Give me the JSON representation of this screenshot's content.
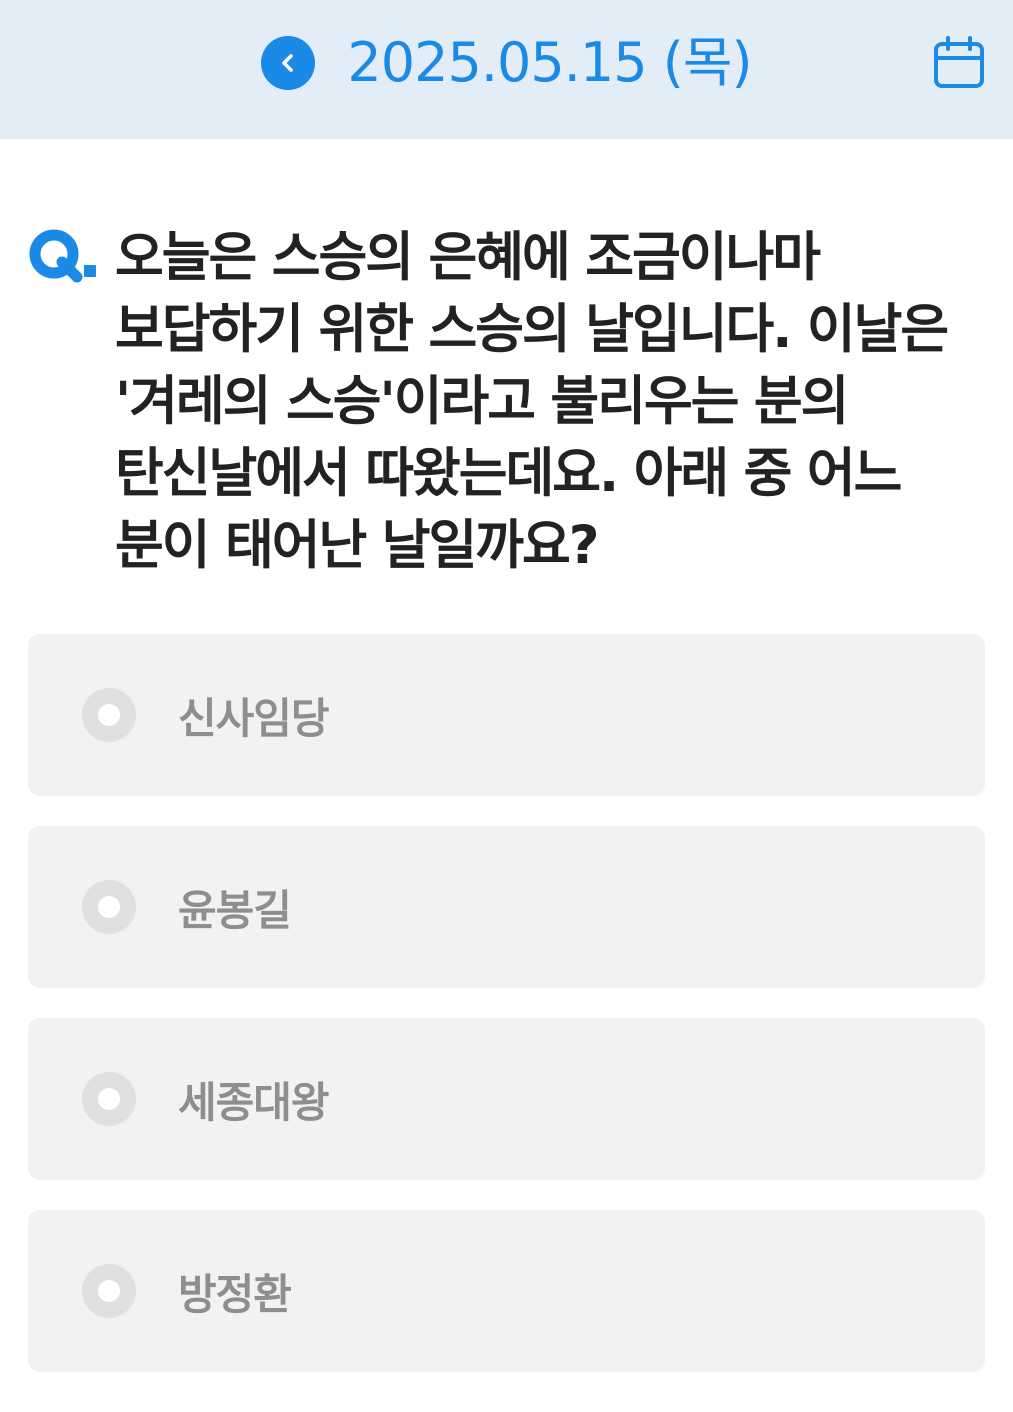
{
  "header": {
    "date": "2025.05.15 (목)",
    "back_icon": "chevron-left-icon",
    "calendar_icon": "calendar-icon",
    "accent_color": "#1a8ae6",
    "background_color": "#e3edf7"
  },
  "question": {
    "marker": "Q.",
    "text": "오늘은 스승의 은혜에 조금이나마 보답하기 위한 스승의 날입니다. 이날은 '겨레의 스승'이라고 불리우는 분의 탄신날에서 따왔는데요. 아래 중 어느 분이 태어난 날일까요?"
  },
  "options": [
    {
      "label": "신사임당",
      "selected": false
    },
    {
      "label": "윤봉길",
      "selected": false
    },
    {
      "label": "세종대왕",
      "selected": false
    },
    {
      "label": "방정환",
      "selected": false
    }
  ]
}
